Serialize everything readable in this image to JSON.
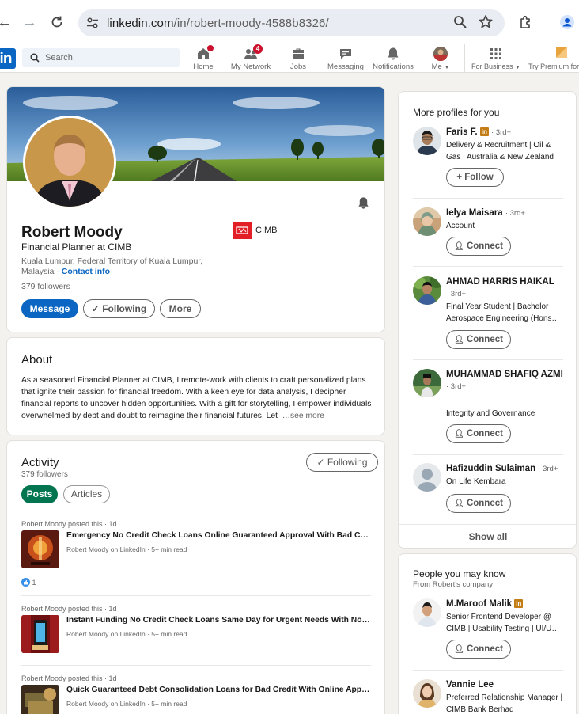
{
  "browser": {
    "url_host": "linkedin.com",
    "url_path": "/in/robert-moody-4588b8326/"
  },
  "header": {
    "search_placeholder": "Search",
    "nav": [
      {
        "label": "Home",
        "icon": "home-icon",
        "badge": ""
      },
      {
        "label": "My Network",
        "icon": "network-icon",
        "badge": "4"
      },
      {
        "label": "Jobs",
        "icon": "briefcase-icon",
        "badge": ""
      },
      {
        "label": "Messaging",
        "icon": "messaging-icon",
        "badge": ""
      },
      {
        "label": "Notifications",
        "icon": "bell-icon",
        "badge": ""
      },
      {
        "label": "Me",
        "icon": "avatar",
        "badge": ""
      },
      {
        "label": "For Business",
        "icon": "grid-icon",
        "badge": ""
      },
      {
        "label": "Try Premium for",
        "icon": "premium-icon",
        "badge": ""
      }
    ]
  },
  "profile": {
    "name": "Robert Moody",
    "headline": "Financial Planner at CIMB",
    "location": "Kuala Lumpur, Federal Territory of Kuala Lumpur, Malaysia",
    "location_sep": " · ",
    "contact_info": "Contact info",
    "followers": "379 followers",
    "company": "CIMB",
    "buttons": {
      "message": "Message",
      "following": "Following",
      "more": "More"
    }
  },
  "about": {
    "title": "About",
    "text": "As a seasoned Financial Planner at CIMB, I remote-work with clients to craft personalized plans that ignite their passion for financial freedom. With a keen eye for data analysis, I decipher financial reports to uncover hidden opportunities. With a gift for storytelling, I empower individuals overwhelmed by debt and doubt to reimagine their financial futures. Let",
    "see_more": "…see more"
  },
  "activity": {
    "title": "Activity",
    "followers": "379 followers",
    "following_btn": "Following",
    "tabs": [
      "Posts",
      "Articles"
    ],
    "posts": [
      {
        "meta": "Robert Moody posted this · 1d",
        "title": "Emergency No Credit Check Loans Online Guaranteed Approval With Bad Cred…",
        "sub": "Robert Moody on LinkedIn · 5+ min read",
        "reactions": "1"
      },
      {
        "meta": "Robert Moody posted this · 1d",
        "title": "Instant Funding No Credit Check Loans Same Day for Urgent Needs With No R…",
        "sub": "Robert Moody on LinkedIn · 5+ min read",
        "reactions": ""
      },
      {
        "meta": "Robert Moody posted this · 1d",
        "title": "Quick Guaranteed Debt Consolidation Loans for Bad Credit With Online Applic…",
        "sub": "Robert Moody on LinkedIn · 5+ min read",
        "reactions": ""
      }
    ]
  },
  "more_profiles": {
    "title": "More profiles for you",
    "people": [
      {
        "name": "Faris F.",
        "premium": true,
        "degree": "· 3rd+",
        "headline": "Delivery & Recruitment | Oil & Gas | Australia & New Zealand",
        "action": "Follow"
      },
      {
        "name": "Ielya Maisara",
        "premium": false,
        "degree": "· 3rd+",
        "headline": "Account",
        "action": "Connect"
      },
      {
        "name": "AHMAD HARRIS HAIKAL",
        "premium": false,
        "degree": "· 3rd+",
        "headline": "Final Year Student | Bachelor Aerospace Engineering (Hons…",
        "action": "Connect"
      },
      {
        "name": "MUHAMMAD SHAFIQ AZMI",
        "premium": false,
        "degree": "· 3rd+",
        "headline": "Integrity and Governance",
        "action": "Connect"
      },
      {
        "name": "Hafizuddin Sulaiman",
        "premium": false,
        "degree": "· 3rd+",
        "headline": "On Life Kembara",
        "action": "Connect"
      }
    ],
    "show_all": "Show all"
  },
  "people_you_may_know": {
    "title": "People you may know",
    "subtitle": "From Robert's company",
    "people": [
      {
        "name": "M.Maroof Malik",
        "premium": true,
        "headline": "Senior Frontend Developer @ CIMB | Usability Testing | UI/U…",
        "action": "Connect"
      },
      {
        "name": "Vannie Lee",
        "premium": false,
        "headline": "Preferred Relationship Manager | CIMB Bank Berhad",
        "action": ""
      }
    ]
  },
  "colors": {
    "brand_blue": "#0a66c2",
    "posts_green": "#01754f",
    "badge_red": "#cb112d",
    "premium_gold": "#c37d16",
    "page_bg": "#f4f2ee"
  }
}
